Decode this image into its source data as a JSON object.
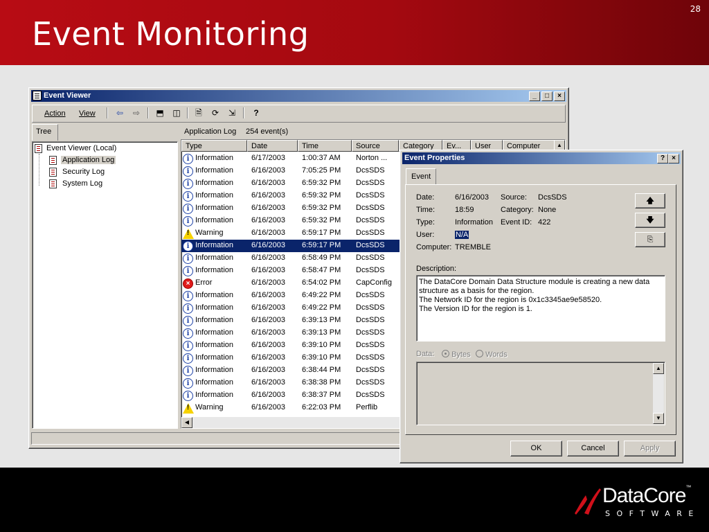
{
  "slide": {
    "title": "Event Monitoring",
    "number": "28"
  },
  "logo": {
    "name": "DataCore",
    "sub": "SOFTWARE"
  },
  "viewer": {
    "title": "Event Viewer",
    "min": "_",
    "max": "□",
    "close": "×",
    "menu": {
      "action": "Action",
      "view": "View"
    },
    "tree_tab": "Tree",
    "tree": [
      "Event Viewer (Local)",
      "Application Log",
      "Security Log",
      "System Log"
    ],
    "list_title": "Application Log",
    "list_count": "254 event(s)",
    "columns": [
      "Type",
      "Date",
      "Time",
      "Source",
      "Category",
      "Ev...",
      "User",
      "Computer"
    ],
    "rows": [
      {
        "type": "Information",
        "date": "6/17/2003",
        "time": "1:00:37 AM",
        "source": "Norton ..."
      },
      {
        "type": "Information",
        "date": "6/16/2003",
        "time": "7:05:25 PM",
        "source": "DcsSDS"
      },
      {
        "type": "Information",
        "date": "6/16/2003",
        "time": "6:59:32 PM",
        "source": "DcsSDS"
      },
      {
        "type": "Information",
        "date": "6/16/2003",
        "time": "6:59:32 PM",
        "source": "DcsSDS"
      },
      {
        "type": "Information",
        "date": "6/16/2003",
        "time": "6:59:32 PM",
        "source": "DcsSDS"
      },
      {
        "type": "Information",
        "date": "6/16/2003",
        "time": "6:59:32 PM",
        "source": "DcsSDS"
      },
      {
        "type": "Warning",
        "date": "6/16/2003",
        "time": "6:59:17 PM",
        "source": "DcsSDS"
      },
      {
        "type": "Information",
        "date": "6/16/2003",
        "time": "6:59:17 PM",
        "source": "DcsSDS"
      },
      {
        "type": "Information",
        "date": "6/16/2003",
        "time": "6:58:49 PM",
        "source": "DcsSDS"
      },
      {
        "type": "Information",
        "date": "6/16/2003",
        "time": "6:58:47 PM",
        "source": "DcsSDS"
      },
      {
        "type": "Error",
        "date": "6/16/2003",
        "time": "6:54:02 PM",
        "source": "CapConfig"
      },
      {
        "type": "Information",
        "date": "6/16/2003",
        "time": "6:49:22 PM",
        "source": "DcsSDS"
      },
      {
        "type": "Information",
        "date": "6/16/2003",
        "time": "6:49:22 PM",
        "source": "DcsSDS"
      },
      {
        "type": "Information",
        "date": "6/16/2003",
        "time": "6:39:13 PM",
        "source": "DcsSDS"
      },
      {
        "type": "Information",
        "date": "6/16/2003",
        "time": "6:39:13 PM",
        "source": "DcsSDS"
      },
      {
        "type": "Information",
        "date": "6/16/2003",
        "time": "6:39:10 PM",
        "source": "DcsSDS"
      },
      {
        "type": "Information",
        "date": "6/16/2003",
        "time": "6:39:10 PM",
        "source": "DcsSDS"
      },
      {
        "type": "Information",
        "date": "6/16/2003",
        "time": "6:38:44 PM",
        "source": "DcsSDS"
      },
      {
        "type": "Information",
        "date": "6/16/2003",
        "time": "6:38:38 PM",
        "source": "DcsSDS"
      },
      {
        "type": "Information",
        "date": "6/16/2003",
        "time": "6:38:37 PM",
        "source": "DcsSDS"
      },
      {
        "type": "Warning",
        "date": "6/16/2003",
        "time": "6:22:03 PM",
        "source": "Perflib"
      }
    ],
    "selected_row": 7
  },
  "props": {
    "title": "Event Properties",
    "help": "?",
    "close": "×",
    "tab": "Event",
    "date_label": "Date:",
    "date": "6/16/2003",
    "source_label": "Source:",
    "source": "DcsSDS",
    "time_label": "Time:",
    "time": "18:59",
    "category_label": "Category:",
    "category": "None",
    "type_label": "Type:",
    "type": "Information",
    "eventid_label": "Event ID:",
    "eventid": "422",
    "user_label": "User:",
    "user": "N/A",
    "computer_label": "Computer:",
    "computer": "TREMBLE",
    "description_label": "Description:",
    "description": "The DataCore Domain Data Structure module is creating a new data structure as a basis for the region.\nThe Network ID for the region is 0x1c3345ae9e58520.\nThe Version ID for the region is 1.",
    "data_label": "Data:",
    "bytes": "Bytes",
    "words": "Words",
    "ok": "OK",
    "cancel": "Cancel",
    "apply": "Apply"
  }
}
